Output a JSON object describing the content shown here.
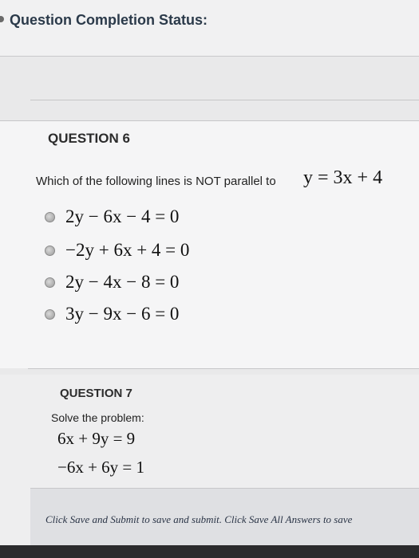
{
  "status": {
    "title": "Question Completion Status:"
  },
  "question6": {
    "heading": "QUESTION 6",
    "prompt": "Which of the following lines is NOT parallel to",
    "prompt_equation": "y = 3x + 4",
    "options": [
      "2y − 6x − 4 = 0",
      "−2y + 6x + 4 = 0",
      "2y − 4x − 8 = 0",
      "3y − 9x − 6 = 0"
    ]
  },
  "question7": {
    "heading": "QUESTION 7",
    "prompt": "Solve the problem:",
    "equations": [
      "6x + 9y = 9",
      "−6x + 6y = 1"
    ]
  },
  "footer": {
    "text": "Click Save and Submit to save and submit. Click Save All Answers to save"
  }
}
